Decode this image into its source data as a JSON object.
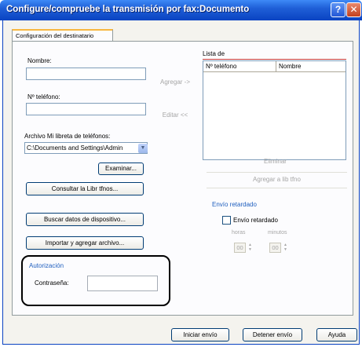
{
  "window": {
    "title": "Configure/compruebe la transmisión por fax:Documento",
    "help_label": "?",
    "close_label": "✕"
  },
  "tab": {
    "label": "Configuración del destinatario"
  },
  "left": {
    "name_label": "Nombre:",
    "name_value": "",
    "phone_label": "Nº teléfono:",
    "phone_value": "",
    "phonebook_label": "Archivo Mi libreta de teléfonos:",
    "phonebook_value": "C:\\Documents and Settings\\Admin",
    "browse_label": "Examinar...",
    "consult_label": "Consultar la Libr tfnos...",
    "search_device_label": "Buscar datos de dispositivo...",
    "import_label": "Importar y agregar archivo..."
  },
  "middle": {
    "add_label": "Agregar ->",
    "edit_label": "Editar <<"
  },
  "list": {
    "title": "Lista de",
    "columns": [
      "Nº teléfono",
      "Nombre"
    ],
    "rows": []
  },
  "right": {
    "delete_label": "Eliminar",
    "add_to_book_label": "Agregar a lib tfno",
    "delayed_group_label": "Envío retardado",
    "delayed_checkbox_label": "Envío retardado",
    "delayed_checked": false,
    "hours_label": "horas",
    "minutes_label": "minutos",
    "hours_value": "00",
    "minutes_value": "00"
  },
  "auth": {
    "group_label": "Autorización",
    "password_label": "Contraseña:",
    "password_value": ""
  },
  "footer": {
    "start_label": "Iniciar envío",
    "stop_label": "Detener envío",
    "help_label": "Ayuda"
  },
  "colors": {
    "titlebar": "#0a43c2",
    "group_label": "#1f5fbf",
    "list_title_underline": "#c63b3b"
  }
}
